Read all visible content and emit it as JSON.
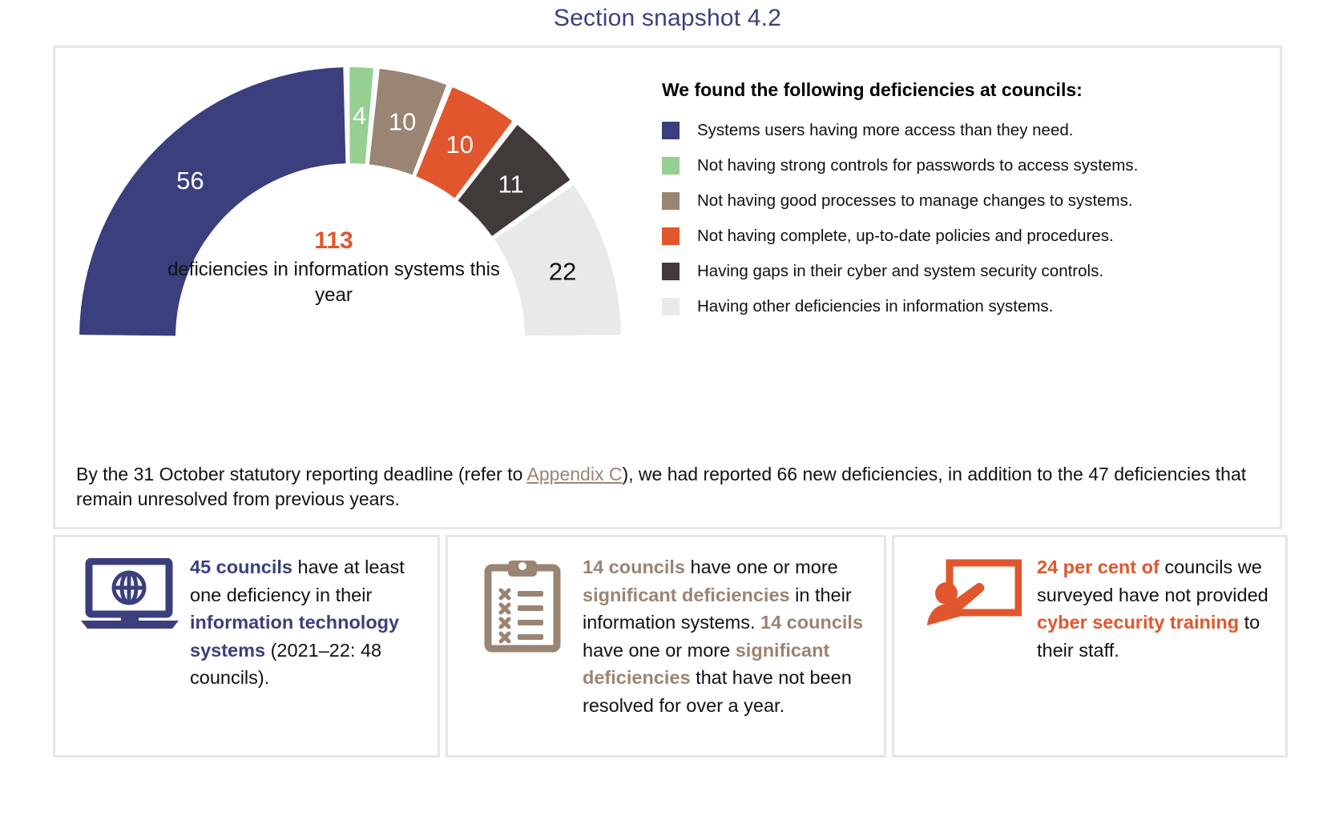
{
  "title": "Section snapshot 4.2",
  "colors": {
    "navy": "#3b3f7d",
    "green": "#95cf92",
    "taupe": "#9a8473",
    "orange": "#e1562c",
    "dark": "#403b39",
    "lightgrey": "#e9e9eb",
    "title": "#3b3f7d",
    "border": "#e6e6e6"
  },
  "chart_data": {
    "type": "pie",
    "title": "113 deficiencies in information systems this year",
    "center_value": "113",
    "center_label": "deficiencies in information systems this year",
    "shape": "half-donut-gauge",
    "total": 113,
    "categories": [
      "Systems users having more access than they need.",
      "Not having strong controls for passwords to access systems.",
      "Not having good processes to manage changes to systems.",
      "Not having complete, up-to-date policies and procedures.",
      "Having gaps in their cyber and system security controls.",
      "Having other deficiencies in information systems."
    ],
    "values": [
      56,
      4,
      10,
      10,
      11,
      22
    ],
    "value_labels": [
      "56",
      "4",
      "10",
      "10",
      "11",
      "22"
    ],
    "colors": [
      "#3b3f7d",
      "#95cf92",
      "#9a8473",
      "#e1562c",
      "#403b39",
      "#e9e9eb"
    ],
    "label_colors": [
      "#ffffff",
      "#ffffff",
      "#ffffff",
      "#ffffff",
      "#ffffff",
      "#111111"
    ],
    "legend_position": "right",
    "legend_title": "We found the following deficiencies at councils:"
  },
  "legend": {
    "title": "We found the following deficiencies at councils:",
    "items": [
      {
        "color": "#3b3f7d",
        "label": "Systems users having more access than they need."
      },
      {
        "color": "#95cf92",
        "label": "Not having strong controls for passwords to access systems."
      },
      {
        "color": "#9a8473",
        "label": "Not having good processes to manage changes to systems."
      },
      {
        "color": "#e1562c",
        "label": "Not having complete, up-to-date policies and procedures."
      },
      {
        "color": "#403b39",
        "label": "Having gaps in their cyber and system security controls."
      },
      {
        "color": "#e9e9eb",
        "label": "Having other deficiencies in information systems."
      }
    ]
  },
  "note": {
    "part1": "By the 31 October statutory reporting deadline (refer to ",
    "link": "Appendix C",
    "part2": "), we had reported 66 new deficiencies, in addition to the 47 deficiencies that remain unresolved from previous years."
  },
  "cards": [
    {
      "icon": "laptop-globe-icon",
      "accent": "#3b3f7d",
      "segments": [
        {
          "text": "45 councils",
          "bold": true
        },
        {
          "text": " have at least one deficiency in their ",
          "bold": false
        },
        {
          "text": "information technology systems",
          "bold": true
        },
        {
          "text": " (2021–22: 48 councils).",
          "bold": false
        }
      ]
    },
    {
      "icon": "clipboard-checklist-icon",
      "accent": "#9a8473",
      "segments": [
        {
          "text": "14 councils",
          "bold": true
        },
        {
          "text": " have one or more ",
          "bold": false
        },
        {
          "text": "significant deficiencies",
          "bold": true
        },
        {
          "text": " in their information systems. ",
          "bold": false
        },
        {
          "text": "14 councils",
          "bold": true
        },
        {
          "text": " have one or more ",
          "bold": false
        },
        {
          "text": "significant deficiencies",
          "bold": true
        },
        {
          "text": " that have not been resolved for over a year.",
          "bold": false
        }
      ]
    },
    {
      "icon": "presenter-whiteboard-icon",
      "accent": "#e1562c",
      "segments": [
        {
          "text": "24 per cent of",
          "bold": true
        },
        {
          "text": " councils we surveyed have not provided ",
          "bold": false
        },
        {
          "text": "cyber security training",
          "bold": true
        },
        {
          "text": " to their staff.",
          "bold": false
        }
      ]
    }
  ]
}
